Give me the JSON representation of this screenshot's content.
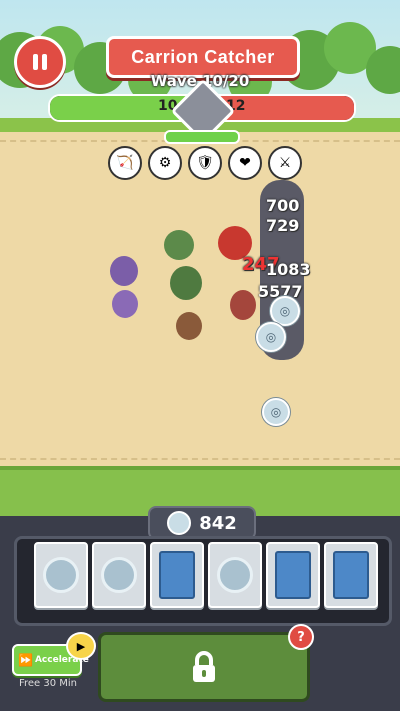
{
  "hud": {
    "title": "Carrion Catcher",
    "wave": "Wave 10/20",
    "ally_count": "10",
    "enemy_count": "12",
    "ally_fraction": 0.45
  },
  "buffs": [
    {
      "icon": "archer-buff-icon"
    },
    {
      "icon": "cannon-buff-icon"
    },
    {
      "icon": "tower-buff-icon"
    },
    {
      "icon": "heart-buff-icon"
    },
    {
      "icon": "warrior-buff-icon"
    }
  ],
  "damage_numbers": [
    "700",
    "729",
    "247",
    "1083",
    "5577"
  ],
  "currency": {
    "amount": "842"
  },
  "slots": [
    {
      "kind": "coin"
    },
    {
      "kind": "coin"
    },
    {
      "kind": "card"
    },
    {
      "kind": "coin"
    },
    {
      "kind": "card"
    },
    {
      "kind": "card"
    }
  ],
  "accelerate": {
    "label": "Accelerate",
    "free_text": "Free 30 Min"
  },
  "help": "?",
  "colors": {
    "accent_red": "#e04c43",
    "accent_green": "#7ad04a"
  }
}
